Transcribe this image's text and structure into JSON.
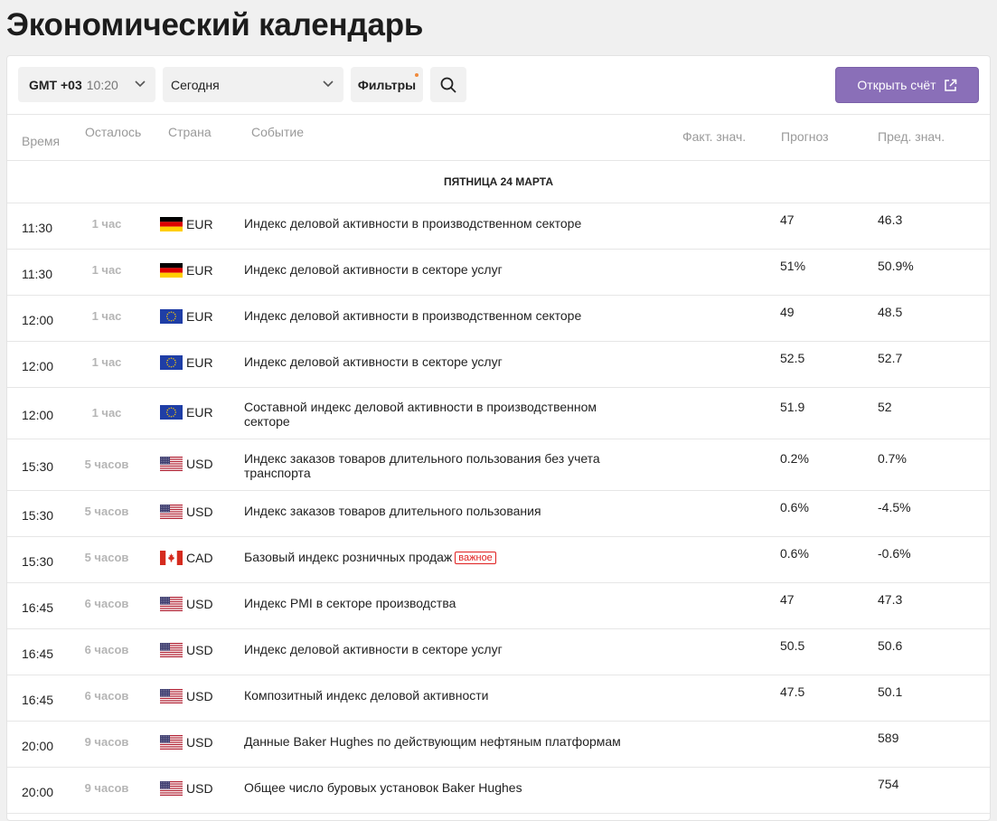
{
  "page": {
    "title": "Экономический календарь"
  },
  "toolbar": {
    "timezone_label": "GMT +03",
    "timezone_time": "10:20",
    "period_value": "Сегодня",
    "filters_label": "Фильтры",
    "open_account_label": "Открыть счёт",
    "colors": {
      "accent": "#8a6fb8",
      "filter_dot": "#f08a3c"
    }
  },
  "table": {
    "headers": {
      "time": "Время",
      "remaining": "Осталось",
      "country": "Страна",
      "event": "Событие",
      "actual": "Факт. знач.",
      "forecast": "Прогноз",
      "previous": "Пред. знач."
    },
    "date_label": "ПЯТНИЦА 24 МАРТА",
    "badge_important": "важное",
    "rows": [
      {
        "time": "11:30",
        "remaining": "1 час",
        "flag": "germany-flag",
        "currency": "EUR",
        "event": "Индекс деловой активности в производственном секторе",
        "forecast": "47",
        "previous": "46.3"
      },
      {
        "time": "11:30",
        "remaining": "1 час",
        "flag": "germany-flag",
        "currency": "EUR",
        "event": "Индекс деловой активности в секторе услуг",
        "forecast": "51%",
        "previous": "50.9%"
      },
      {
        "time": "12:00",
        "remaining": "1 час",
        "flag": "eu-flag",
        "currency": "EUR",
        "event": "Индекс деловой активности в производственном секторе",
        "forecast": "49",
        "previous": "48.5"
      },
      {
        "time": "12:00",
        "remaining": "1 час",
        "flag": "eu-flag",
        "currency": "EUR",
        "event": "Индекс деловой активности в секторе услуг",
        "forecast": "52.5",
        "previous": "52.7"
      },
      {
        "time": "12:00",
        "remaining": "1 час",
        "flag": "eu-flag",
        "currency": "EUR",
        "event": "Составной индекс деловой активности в производственном секторе",
        "forecast": "51.9",
        "previous": "52"
      },
      {
        "time": "15:30",
        "remaining": "5 часов",
        "flag": "usa-flag",
        "currency": "USD",
        "event": "Индекс заказов товаров длительного пользования без учета транспорта",
        "forecast": "0.2%",
        "previous": "0.7%"
      },
      {
        "time": "15:30",
        "remaining": "5 часов",
        "flag": "usa-flag",
        "currency": "USD",
        "event": "Индекс заказов товаров длительного пользования",
        "forecast": "0.6%",
        "previous": "-4.5%"
      },
      {
        "time": "15:30",
        "remaining": "5 часов",
        "flag": "canada-flag",
        "currency": "CAD",
        "event": "Базовый индекс розничных продаж",
        "important": true,
        "forecast": "0.6%",
        "previous": "-0.6%"
      },
      {
        "time": "16:45",
        "remaining": "6 часов",
        "flag": "usa-flag",
        "currency": "USD",
        "event": "Индекс PMI в секторе производства",
        "forecast": "47",
        "previous": "47.3"
      },
      {
        "time": "16:45",
        "remaining": "6 часов",
        "flag": "usa-flag",
        "currency": "USD",
        "event": "Индекс деловой активности в секторе услуг",
        "forecast": "50.5",
        "previous": "50.6"
      },
      {
        "time": "16:45",
        "remaining": "6 часов",
        "flag": "usa-flag",
        "currency": "USD",
        "event": "Композитный индекс деловой активности",
        "forecast": "47.5",
        "previous": "50.1"
      },
      {
        "time": "20:00",
        "remaining": "9 часов",
        "flag": "usa-flag",
        "currency": "USD",
        "event": "Данные Baker Hughes по действующим нефтяным платформам",
        "forecast": "",
        "previous": "589"
      },
      {
        "time": "20:00",
        "remaining": "9 часов",
        "flag": "usa-flag",
        "currency": "USD",
        "event": "Общее число буровых установок Baker Hughes",
        "forecast": "",
        "previous": "754"
      }
    ]
  }
}
